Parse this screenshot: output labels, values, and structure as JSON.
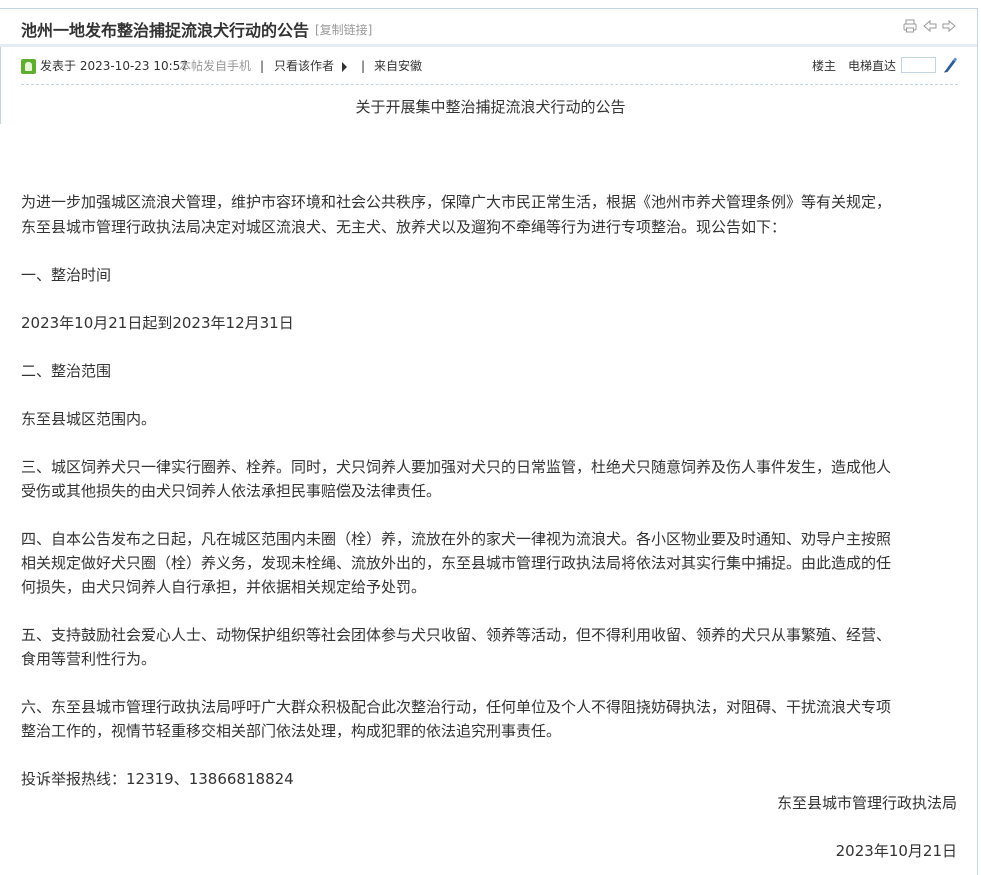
{
  "thread": {
    "title": "池州一地发布整治捕捉流浪犬行动的公告",
    "copy_link": "[复制链接]"
  },
  "icons": {
    "print": "printer-icon",
    "prev": "prev-thread-icon",
    "next": "next-thread-icon",
    "author": "author-icon",
    "jump": "pen-jump-icon"
  },
  "post": {
    "posted_at": "发表于 2023-10-23 10:57",
    "mobile_note": "本帖发自手机",
    "only_author": "只看该作者",
    "source": "来自安徽",
    "floor": "楼主",
    "jump_label": "电梯直达",
    "jump_value": ""
  },
  "article": {
    "heading": "关于开展集中整治捕捉流浪犬行动的公告",
    "lines": [
      "为进一步加强城区流浪犬管理，维护市容环境和社会公共秩序，保障广大市民正常生活，根据《池州市养犬管理条例》等有关规定，",
      "东至县城市管理行政执法局决定对城区流浪犬、无主犬、放养犬以及遛狗不牵绳等行为进行专项整治。现公告如下：",
      "一、整治时间",
      "2023年10月21日起到2023年12月31日",
      "二、整治范围",
      "东至县城区范围内。",
      "三、城区饲养犬只一律实行圈养、栓养。同时，犬只饲养人要加强对犬只的日常监管，杜绝犬只随意饲养及伤人事件发生，造成他人",
      "受伤或其他损失的由犬只饲养人依法承担民事赔偿及法律责任。",
      "四、自本公告发布之日起，凡在城区范围内未圈（栓）养，流放在外的家犬一律视为流浪犬。各小区物业要及时通知、劝导户主按照",
      "相关规定做好犬只圈（栓）养义务，发现未栓绳、流放外出的，东至县城市管理行政执法局将依法对其实行集中捕捉。由此造成的任",
      "何损失，由犬只饲养人自行承担，并依据相关规定给予处罚。",
      "五、支持鼓励社会爱心人士、动物保护组织等社会团体参与犬只收留、领养等活动，但不得利用收留、领养的犬只从事繁殖、经营、",
      "食用等营利性行为。",
      "六、东至县城市管理行政执法局呼吁广大群众积极配合此次整治行动，任何单位及个人不得阻挠妨碍执法，对阻碍、干扰流浪犬专项",
      "整治工作的，视情节轻重移交相关部门依法处理，构成犯罪的依法追究刑事责任。",
      "投诉举报热线：12319、13866818824"
    ],
    "signature": "东至县城市管理行政执法局",
    "date": "2023年10月21日"
  }
}
